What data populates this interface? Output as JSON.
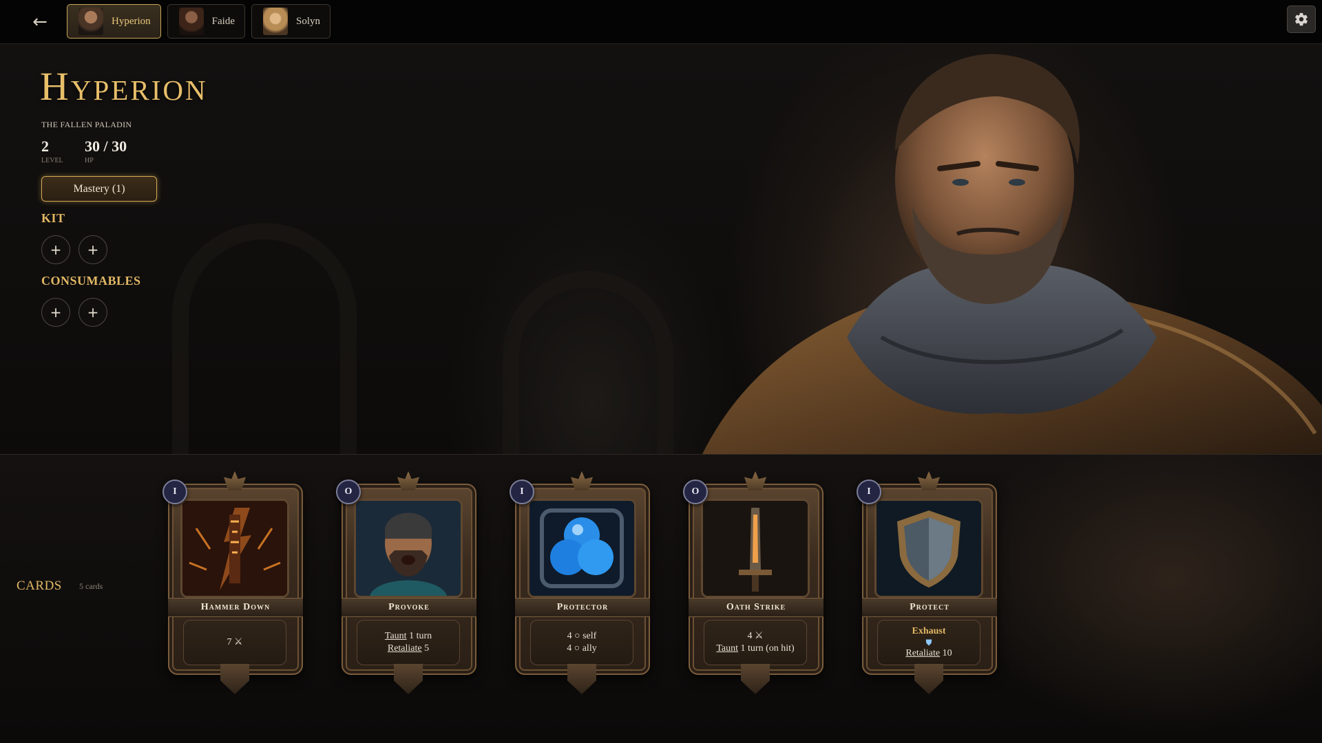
{
  "nav": {
    "back_icon": "←",
    "tabs": [
      {
        "label": "Hyperion",
        "active": true
      },
      {
        "label": "Faide",
        "active": false
      },
      {
        "label": "Solyn",
        "active": false
      }
    ],
    "settings_icon": "gear-icon"
  },
  "hero": {
    "name": "Hyperion",
    "subtitle": "THE FALLEN PALADIN",
    "level": {
      "value": "2",
      "label": "LEVEL"
    },
    "hp": {
      "value": "30 / 30",
      "label": "HP"
    },
    "mastery_label": "Mastery (1)",
    "kit_heading": "KIT",
    "consumables_heading": "CONSUMABLES",
    "slot_symbol": "+"
  },
  "cards_section": {
    "heading": "CARDS",
    "count": "5 cards",
    "cards": [
      {
        "cost": "I",
        "name": "Hammer Down",
        "line1": "7 ⚔",
        "line2": "",
        "line3": ""
      },
      {
        "cost": "O",
        "name": "Provoke",
        "line1_kw": "Taunt",
        "line1_rest": " 1 turn",
        "line2_kw": "Retaliate",
        "line2_rest": " 5"
      },
      {
        "cost": "I",
        "name": "Protector",
        "line1": "4 ○ self",
        "line2": "4 ○ ally"
      },
      {
        "cost": "O",
        "name": "Oath Strike",
        "line1": "4 ⚔",
        "line2_kw": "Taunt",
        "line2_rest": " 1 turn (on hit)"
      },
      {
        "cost": "I",
        "name": "Protect",
        "line1": "Exhaust",
        "line2": "⛊",
        "line3_kw": "Retaliate",
        "line3_rest": " 10"
      }
    ]
  },
  "colors": {
    "accent_gold": "#e2b864",
    "cost_badge": "#232542"
  }
}
